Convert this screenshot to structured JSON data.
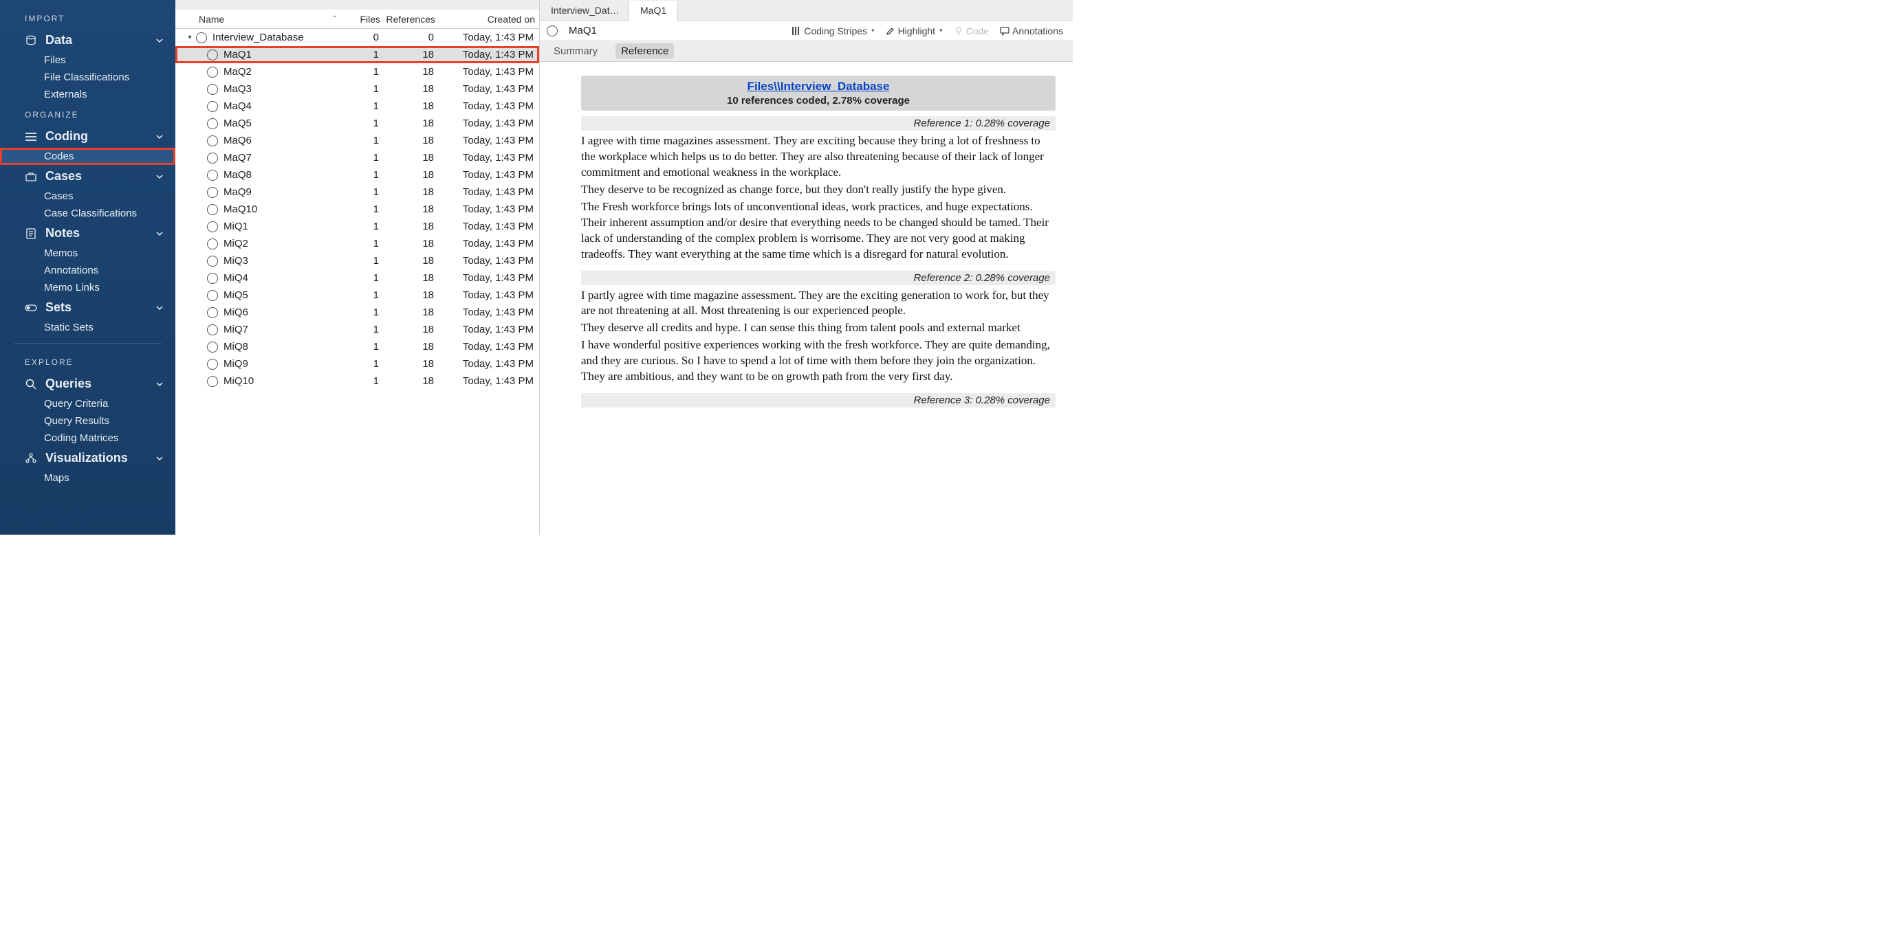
{
  "sidebar": {
    "sections": {
      "import": {
        "label": "IMPORT"
      },
      "organize": {
        "label": "ORGANIZE"
      },
      "explore": {
        "label": "EXPLORE"
      }
    },
    "groups": {
      "data": {
        "label": "Data",
        "items": [
          "Files",
          "File Classifications",
          "Externals"
        ]
      },
      "coding": {
        "label": "Coding",
        "items": [
          "Codes"
        ]
      },
      "cases": {
        "label": "Cases",
        "items": [
          "Cases",
          "Case Classifications"
        ]
      },
      "notes": {
        "label": "Notes",
        "items": [
          "Memos",
          "Annotations",
          "Memo Links"
        ]
      },
      "sets": {
        "label": "Sets",
        "items": [
          "Static Sets"
        ]
      },
      "queries": {
        "label": "Queries",
        "items": [
          "Query Criteria",
          "Query Results",
          "Coding Matrices"
        ]
      },
      "visualizations": {
        "label": "Visualizations",
        "items": [
          "Maps"
        ]
      }
    }
  },
  "list": {
    "columns": {
      "name": "Name",
      "files": "Files",
      "refs": "References",
      "created": "Created on"
    },
    "parent": {
      "name": "Interview_Database",
      "files": "0",
      "refs": "0",
      "created": "Today, 1:43 PM"
    },
    "rows": [
      {
        "name": "MaQ1",
        "files": "1",
        "refs": "18",
        "created": "Today, 1:43 PM",
        "selected": true,
        "outlined": true
      },
      {
        "name": "MaQ2",
        "files": "1",
        "refs": "18",
        "created": "Today, 1:43 PM"
      },
      {
        "name": "MaQ3",
        "files": "1",
        "refs": "18",
        "created": "Today, 1:43 PM"
      },
      {
        "name": "MaQ4",
        "files": "1",
        "refs": "18",
        "created": "Today, 1:43 PM"
      },
      {
        "name": "MaQ5",
        "files": "1",
        "refs": "18",
        "created": "Today, 1:43 PM"
      },
      {
        "name": "MaQ6",
        "files": "1",
        "refs": "18",
        "created": "Today, 1:43 PM"
      },
      {
        "name": "MaQ7",
        "files": "1",
        "refs": "18",
        "created": "Today, 1:43 PM"
      },
      {
        "name": "MaQ8",
        "files": "1",
        "refs": "18",
        "created": "Today, 1:43 PM"
      },
      {
        "name": "MaQ9",
        "files": "1",
        "refs": "18",
        "created": "Today, 1:43 PM"
      },
      {
        "name": "MaQ10",
        "files": "1",
        "refs": "18",
        "created": "Today, 1:43 PM"
      },
      {
        "name": "MiQ1",
        "files": "1",
        "refs": "18",
        "created": "Today, 1:43 PM"
      },
      {
        "name": "MiQ2",
        "files": "1",
        "refs": "18",
        "created": "Today, 1:43 PM"
      },
      {
        "name": "MiQ3",
        "files": "1",
        "refs": "18",
        "created": "Today, 1:43 PM"
      },
      {
        "name": "MiQ4",
        "files": "1",
        "refs": "18",
        "created": "Today, 1:43 PM"
      },
      {
        "name": "MiQ5",
        "files": "1",
        "refs": "18",
        "created": "Today, 1:43 PM"
      },
      {
        "name": "MiQ6",
        "files": "1",
        "refs": "18",
        "created": "Today, 1:43 PM"
      },
      {
        "name": "MiQ7",
        "files": "1",
        "refs": "18",
        "created": "Today, 1:43 PM"
      },
      {
        "name": "MiQ8",
        "files": "1",
        "refs": "18",
        "created": "Today, 1:43 PM"
      },
      {
        "name": "MiQ9",
        "files": "1",
        "refs": "18",
        "created": "Today, 1:43 PM"
      },
      {
        "name": "MiQ10",
        "files": "1",
        "refs": "18",
        "created": "Today, 1:43 PM"
      }
    ]
  },
  "detail": {
    "tabs": [
      {
        "label": "Interview_Dat…",
        "active": false
      },
      {
        "label": "MaQ1",
        "active": true
      }
    ],
    "title": "MaQ1",
    "toolbar": {
      "coding_stripes": "Coding Stripes",
      "highlight": "Highlight",
      "code": "Code",
      "annotations": "Annotations"
    },
    "subtabs": {
      "summary": "Summary",
      "reference": "Reference"
    },
    "source_link": "Files\\\\Interview_Database",
    "coverage_line": "10 references coded, 2.78% coverage",
    "references": [
      {
        "bar": "Reference 1: 0.28% coverage",
        "paras": [
          "I agree with time magazines assessment.  They are exciting because they bring a lot of freshness to the workplace which helps us to do better. They are also threatening because of their lack of longer commitment and emotional weakness in the workplace.",
          "They deserve to be recognized as change force, but they don't really justify the hype given.",
          "The Fresh workforce brings lots of unconventional ideas, work practices, and huge expectations. Their inherent assumption and/or desire that everything needs to be changed should be tamed. Their lack of understanding of the complex problem is worrisome. They are not very good at making tradeoffs. They want everything at the same time which is a disregard for natural evolution."
        ]
      },
      {
        "bar": "Reference 2: 0.28% coverage",
        "paras": [
          "I partly agree with time magazine assessment. They are the exciting generation to work for, but they are not threatening at all. Most threatening is our experienced people.",
          "They deserve all credits and hype. I can sense this thing from talent pools and external market",
          "I have wonderful positive experiences working with the fresh workforce. They are quite demanding, and they are curious. So I have to spend a lot of time with them before they join the organization. They are ambitious, and they want to be on growth path from the very first day."
        ]
      },
      {
        "bar": "Reference 3: 0.28% coverage",
        "paras": []
      }
    ]
  }
}
